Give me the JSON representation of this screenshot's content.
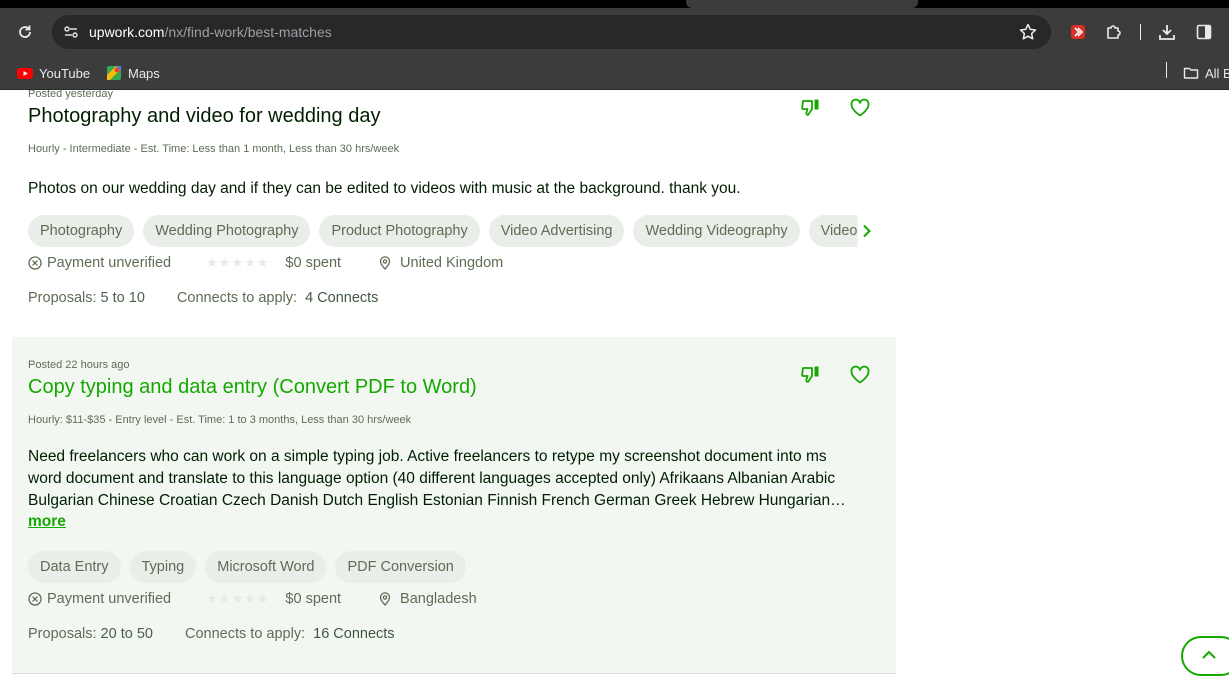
{
  "browser": {
    "url_host": "upwork.com",
    "url_path": "/nx/find-work/best-matches",
    "bookmarks": [
      {
        "label": "YouTube",
        "icon": "youtube-icon"
      },
      {
        "label": "Maps",
        "icon": "maps-icon"
      }
    ],
    "all_bookmarks_label": "All B"
  },
  "jobs": [
    {
      "posted": "Posted yesterday",
      "title": "Photography and video for wedding day",
      "meta": "Hourly - Intermediate - Est. Time: Less than 1 month, Less than 30 hrs/week",
      "description": "Photos on our wedding day and if they can be edited to videos with music at the background. thank you.",
      "tags": [
        "Photography",
        "Wedding Photography",
        "Product Photography",
        "Video Advertising",
        "Wedding Videography",
        "Videography"
      ],
      "payment": "Payment unverified",
      "spent": "$0 spent",
      "location": "United Kingdom",
      "proposals_label": "Proposals:",
      "proposals": "5 to 10",
      "connects_label": "Connects to apply:",
      "connects": "4 Connects"
    },
    {
      "posted": "Posted 22 hours ago",
      "title": "Copy typing and data entry (Convert PDF to Word)",
      "meta": "Hourly: $11-$35 - Entry level - Est. Time: 1 to 3 months, Less than 30 hrs/week",
      "description_lines": [
        "Need freelancers who can work on a simple typing job. Active freelancers to retype my screenshot document into ms",
        "word document and translate to this language option (40 different languages accepted only) Afrikaans Albanian Arabic",
        "Bulgarian Chinese Croatian Czech Danish Dutch English Estonian Finnish French German Greek Hebrew Hungarian…"
      ],
      "more_label": "more",
      "tags": [
        "Data Entry",
        "Typing",
        "Microsoft Word",
        "PDF Conversion"
      ],
      "payment": "Payment unverified",
      "spent": "$0 spent",
      "location": "Bangladesh",
      "proposals_label": "Proposals:",
      "proposals": "20 to 50",
      "connects_label": "Connects to apply:",
      "connects": "16 Connects"
    }
  ],
  "colors": {
    "brand_green": "#14a800",
    "text_dark": "#001e00",
    "text_muted": "#5e6d55",
    "chrome_bg": "#3c3c3c"
  }
}
